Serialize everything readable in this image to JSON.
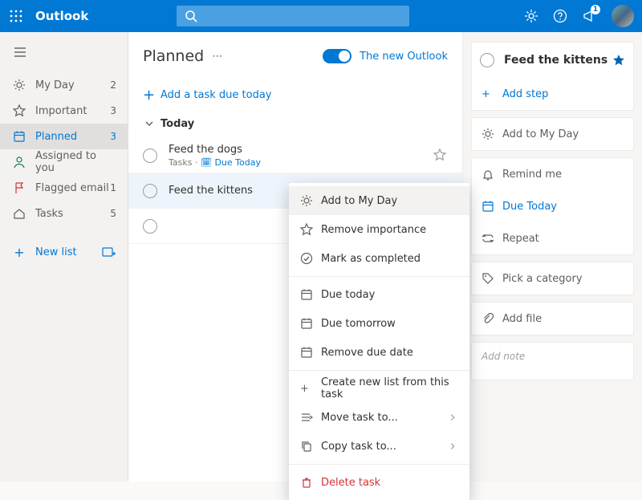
{
  "header": {
    "brand": "Outlook",
    "notif_count": "1"
  },
  "sidebar": {
    "items": [
      {
        "label": "My Day",
        "count": "2"
      },
      {
        "label": "Important",
        "count": "3"
      },
      {
        "label": "Planned",
        "count": "3"
      },
      {
        "label": "Assigned to you",
        "count": ""
      },
      {
        "label": "Flagged email",
        "count": "1"
      },
      {
        "label": "Tasks",
        "count": "5"
      }
    ],
    "new_list": "New list"
  },
  "main": {
    "title": "Planned",
    "toggle_label": "The new Outlook",
    "add_task": "Add a task due today",
    "section": "Today",
    "tasks": [
      {
        "title": "Feed the dogs",
        "meta_list": "Tasks",
        "meta_due": "Due Today",
        "starred": false
      },
      {
        "title": "Feed the kittens",
        "meta_list": "",
        "meta_due": "",
        "starred": true
      },
      {
        "title": "",
        "meta_list": "",
        "meta_due": "",
        "starred": false
      }
    ]
  },
  "ctx": {
    "add_my_day": "Add to My Day",
    "remove_importance": "Remove importance",
    "mark_completed": "Mark as completed",
    "due_today": "Due today",
    "due_tomorrow": "Due tomorrow",
    "remove_due": "Remove due date",
    "create_list": "Create new list from this task",
    "move_to": "Move task to...",
    "copy_to": "Copy task to...",
    "delete": "Delete task"
  },
  "detail": {
    "title": "Feed the kittens",
    "add_step": "Add step",
    "add_my_day": "Add to My Day",
    "remind": "Remind me",
    "due": "Due Today",
    "repeat": "Repeat",
    "category": "Pick a category",
    "add_file": "Add file",
    "note_placeholder": "Add note"
  }
}
